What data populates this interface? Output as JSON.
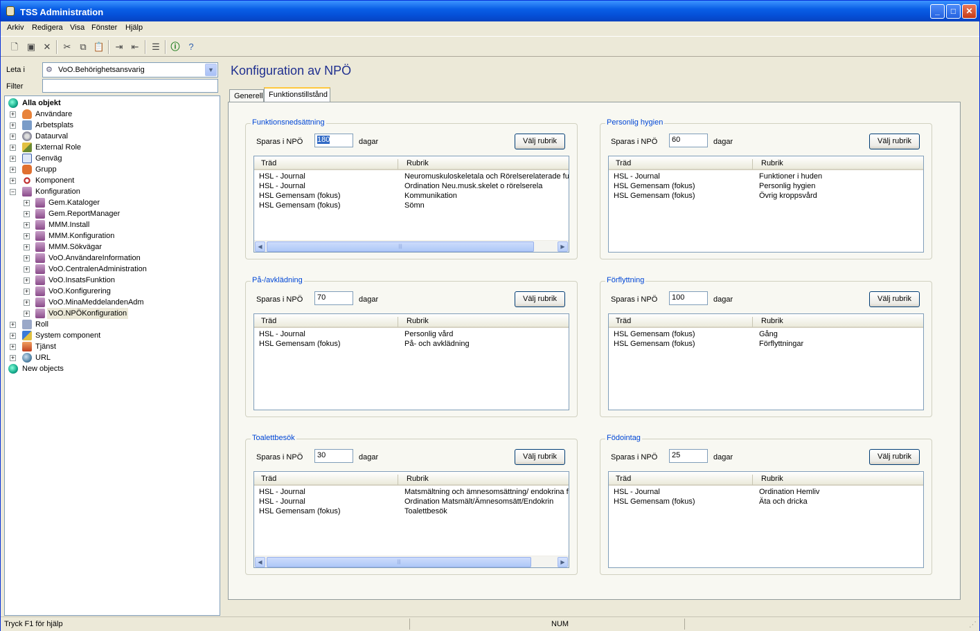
{
  "window": {
    "title": "TSS Administration"
  },
  "menu": [
    "Arkiv",
    "Redigera",
    "Visa",
    "Fönster",
    "Hjälp"
  ],
  "left": {
    "leta_label": "Leta i",
    "leta_value": "VoO.Behörighetsansvarig",
    "filter_label": "Filter",
    "filter_value": "",
    "tree": {
      "root": "Alla objekt",
      "items": [
        "Användare",
        "Arbetsplats",
        "Dataurval",
        "External Role",
        "Genväg",
        "Grupp",
        "Komponent",
        "Konfiguration"
      ],
      "children": [
        "Gem.Kataloger",
        "Gem.ReportManager",
        "MMM.Install",
        "MMM.Konfiguration",
        "MMM.Sökvägar",
        "VoO.AnvändareInformation",
        "VoO.CentralenAdministration",
        "VoO.InsatsFunktion",
        "VoO.Konfigurering",
        "VoO.MinaMeddelandenAdm",
        "VoO.NPÖKonfiguration"
      ],
      "after": [
        "Roll",
        "System component",
        "Tjänst",
        "URL"
      ],
      "new_objects": "New objects"
    }
  },
  "main": {
    "title": "Konfiguration av NPÖ",
    "tabs": [
      "Generell",
      "Funktionstillstånd"
    ],
    "sparas_label": "Sparas i NPÖ",
    "dagar_label": "dagar",
    "valj_label": "Välj rubrik",
    "col_trad": "Träd",
    "col_rubrik": "Rubrik",
    "groups": [
      {
        "title": "Funktionsnedsättning",
        "days": "180",
        "rows": [
          [
            "HSL - Journal",
            "Neuromuskuloskeletala och Rörelserelaterade fun"
          ],
          [
            "HSL - Journal",
            "Ordination Neu.musk.skelet o rörelserela"
          ],
          [
            "HSL Gemensam (fokus)",
            "Kommunikation"
          ],
          [
            "HSL Gemensam (fokus)",
            "Sömn"
          ]
        ]
      },
      {
        "title": "Personlig hygien",
        "days": "60",
        "rows": [
          [
            "HSL - Journal",
            "Funktioner i huden"
          ],
          [
            "HSL Gemensam (fokus)",
            "Personlig hygien"
          ],
          [
            "HSL Gemensam (fokus)",
            "Övrig kroppsvård"
          ]
        ]
      },
      {
        "title": "På-/avklädning",
        "days": "70",
        "rows": [
          [
            "HSL - Journal",
            "Personlig vård"
          ],
          [
            "HSL Gemensam (fokus)",
            "På- och avklädning"
          ]
        ]
      },
      {
        "title": "Förflyttning",
        "days": "100",
        "rows": [
          [
            "HSL Gemensam (fokus)",
            "Gång"
          ],
          [
            "HSL Gemensam (fokus)",
            "Förflyttningar"
          ]
        ]
      },
      {
        "title": "Toalettbesök",
        "days": "30",
        "rows": [
          [
            "HSL - Journal",
            "Matsmältning och ämnesomsättning/ endokrina fu"
          ],
          [
            "HSL - Journal",
            "Ordination Matsmält/Ämnesomsätt/Endokrin"
          ],
          [
            "HSL Gemensam (fokus)",
            "Toalettbesök"
          ]
        ]
      },
      {
        "title": "Födointag",
        "days": "25",
        "rows": [
          [
            "HSL - Journal",
            "Ordination Hemliv"
          ],
          [
            "HSL Gemensam (fokus)",
            "Äta och dricka"
          ]
        ]
      }
    ]
  },
  "status": {
    "help": "Tryck F1 för hjälp",
    "num": "NUM"
  }
}
